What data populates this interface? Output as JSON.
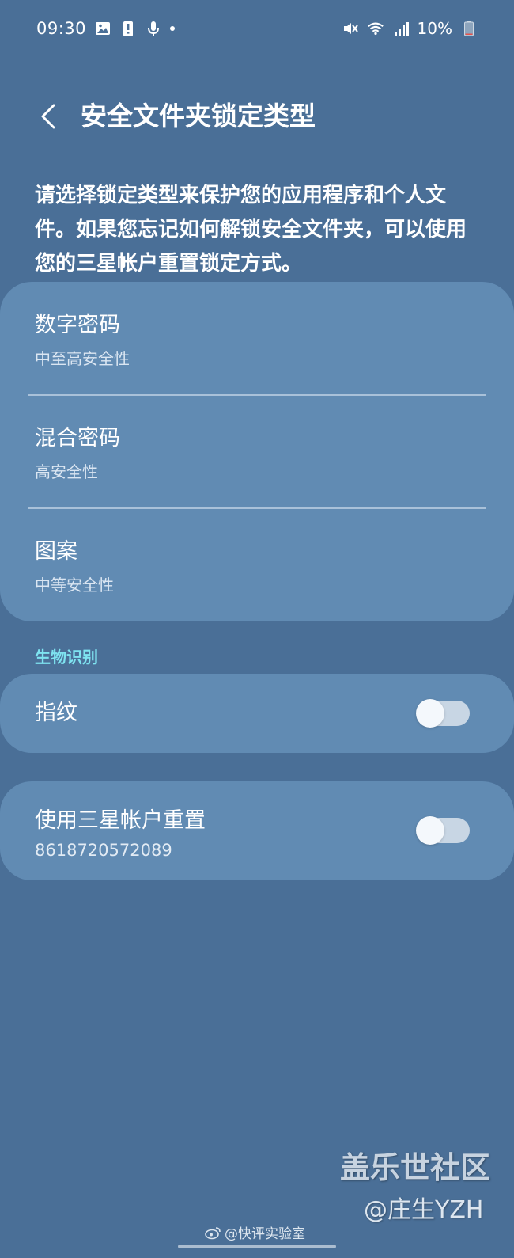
{
  "status_bar": {
    "time": "09:30",
    "battery_percent": "10%",
    "left_icons": [
      "gallery-icon",
      "alert-icon",
      "microphone-icon",
      "dot-icon"
    ],
    "right_icons": [
      "mute-icon",
      "wifi-icon",
      "signal-icon",
      "battery-icon"
    ],
    "battery_level": 0.1
  },
  "header": {
    "title": "安全文件夹锁定类型"
  },
  "description": "请选择锁定类型来保护您的应用程序和个人文件。如果您忘记如何解锁安全文件夹，可以使用您的三星帐户重置锁定方式。",
  "lock_types": [
    {
      "title": "数字密码",
      "subtitle": "中至高安全性"
    },
    {
      "title": "混合密码",
      "subtitle": "高安全性"
    },
    {
      "title": "图案",
      "subtitle": "中等安全性"
    }
  ],
  "biometrics": {
    "section_label": "生物识别",
    "fingerprint": {
      "label": "指纹",
      "enabled": false
    }
  },
  "samsung_reset": {
    "label": "使用三星帐户重置",
    "account": "8618720572089",
    "enabled": false
  },
  "watermarks": {
    "site": "盖乐世社区",
    "user": "@庄生YZH",
    "weibo": "@快评实验室"
  },
  "colors": {
    "background": "#4a6f97",
    "card": "#618bb3",
    "section_accent": "#7ee3f0",
    "battery_low": "#e8514a"
  }
}
